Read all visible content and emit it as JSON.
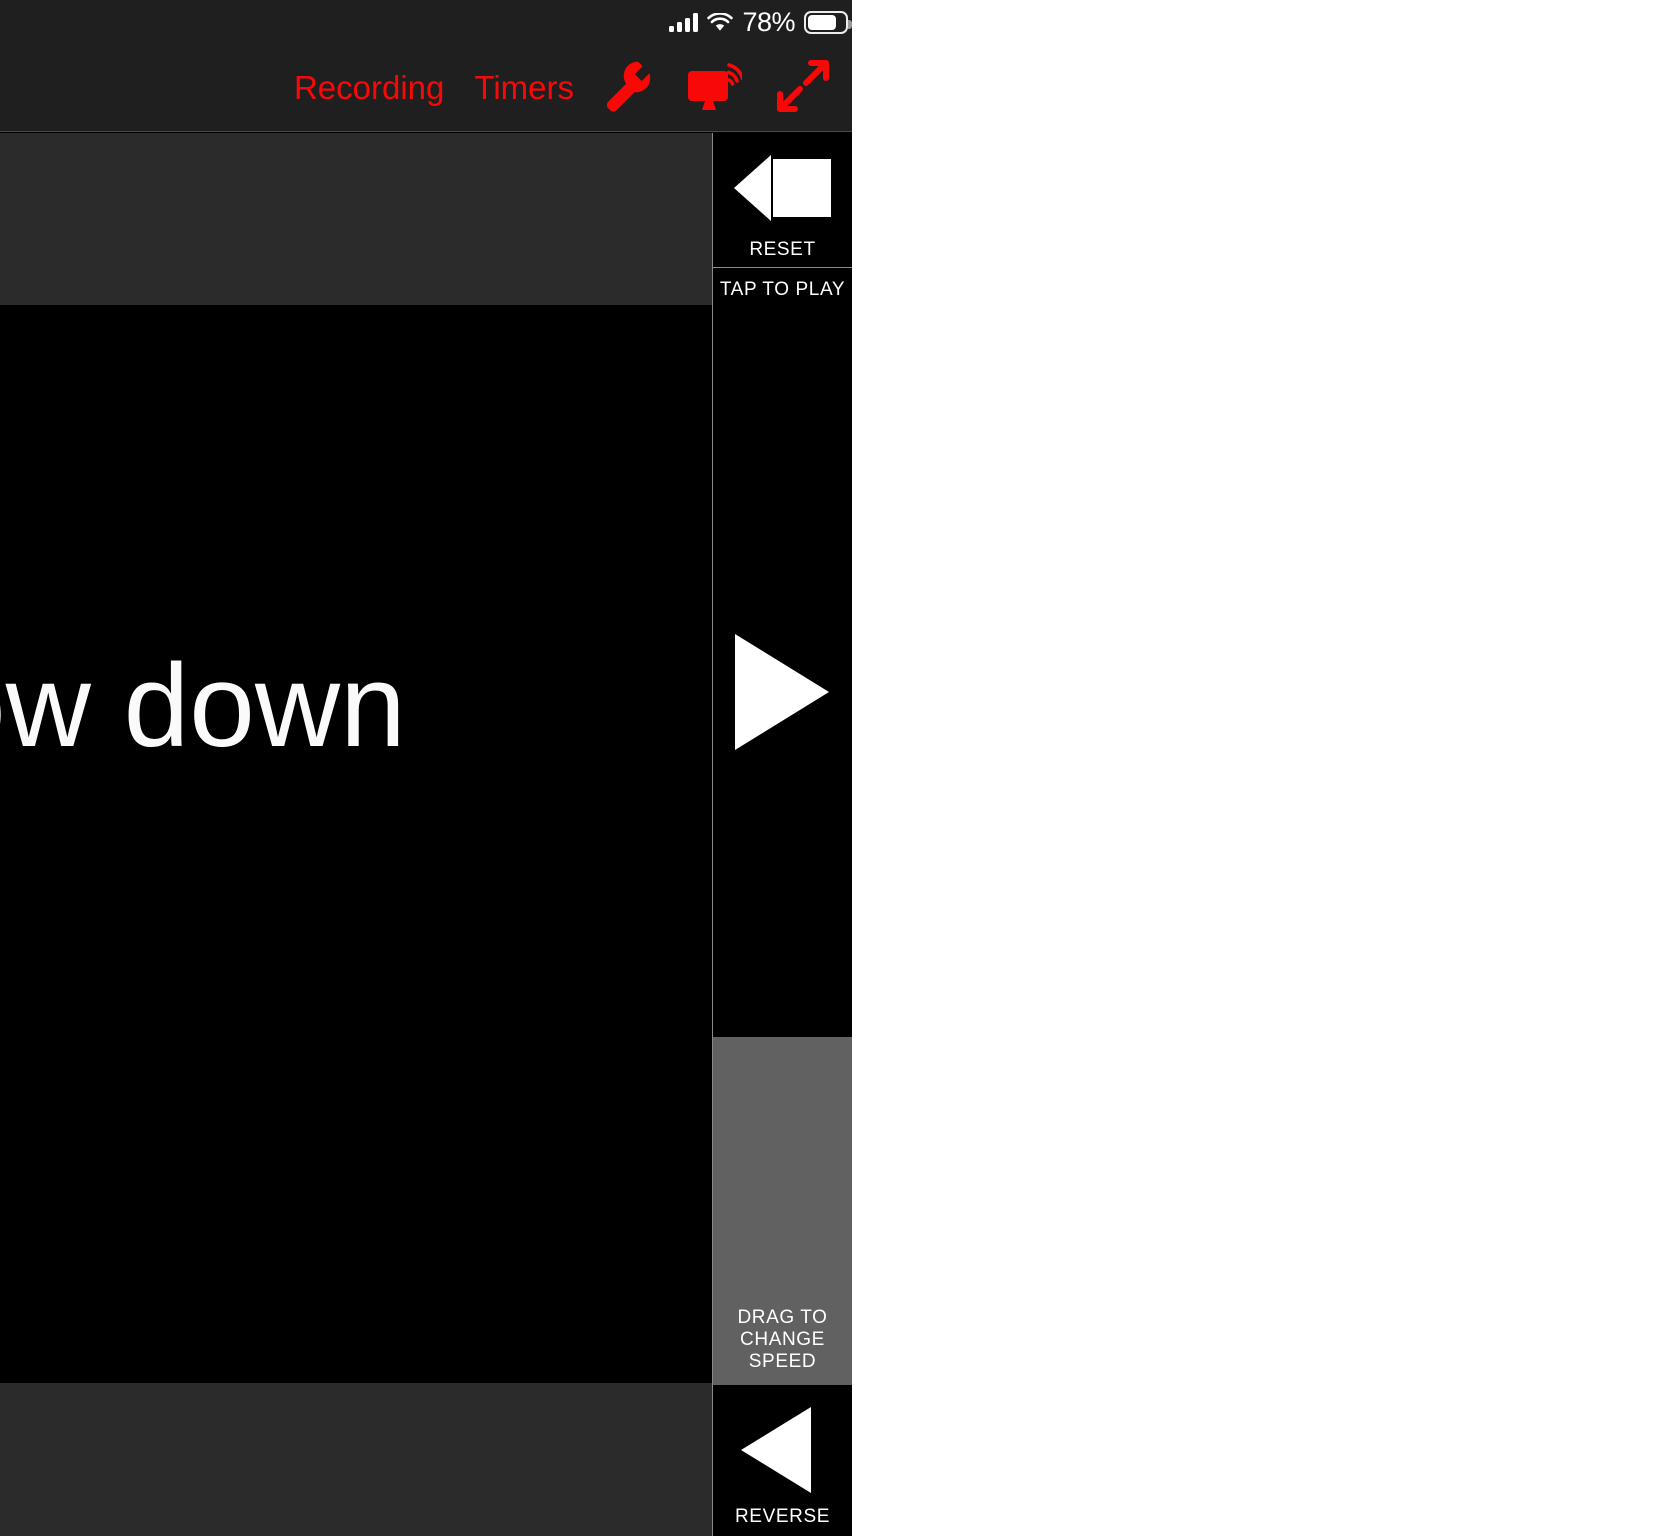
{
  "status_bar": {
    "signal_icon": "cellular-signal-icon",
    "wifi_icon": "wifi-icon",
    "battery_percent": "78%",
    "battery_icon": "battery-icon"
  },
  "nav_bar": {
    "links": [
      {
        "label": "Recording",
        "name": "nav-link-recording"
      },
      {
        "label": "Timers",
        "name": "nav-link-timers"
      }
    ],
    "icons": [
      {
        "name": "wrench-icon"
      },
      {
        "name": "airplay-screen-mirroring-icon"
      },
      {
        "name": "expand-fullscreen-icon"
      }
    ],
    "accent_color": "#f90808"
  },
  "video": {
    "caption_text": "ow down",
    "background_color": "#000000"
  },
  "controls": {
    "reset": {
      "label": "RESET",
      "glyph": "skip-to-start-icon"
    },
    "play": {
      "hint_label": "TAP TO PLAY",
      "glyph": "play-triangle-icon"
    },
    "speed": {
      "label": "DRAG TO\nCHANGE\nSPEED",
      "line1": "DRAG TO",
      "line2": "CHANGE",
      "line3": "SPEED",
      "background_color": "#616161"
    },
    "reverse": {
      "label": "REVERSE",
      "glyph": "reverse-triangle-icon"
    }
  },
  "theme": {
    "chrome_background": "#1f1f1f",
    "panel_background": "#2b2b2b",
    "accent": "#f90808",
    "separator": "#8a8a8a"
  }
}
